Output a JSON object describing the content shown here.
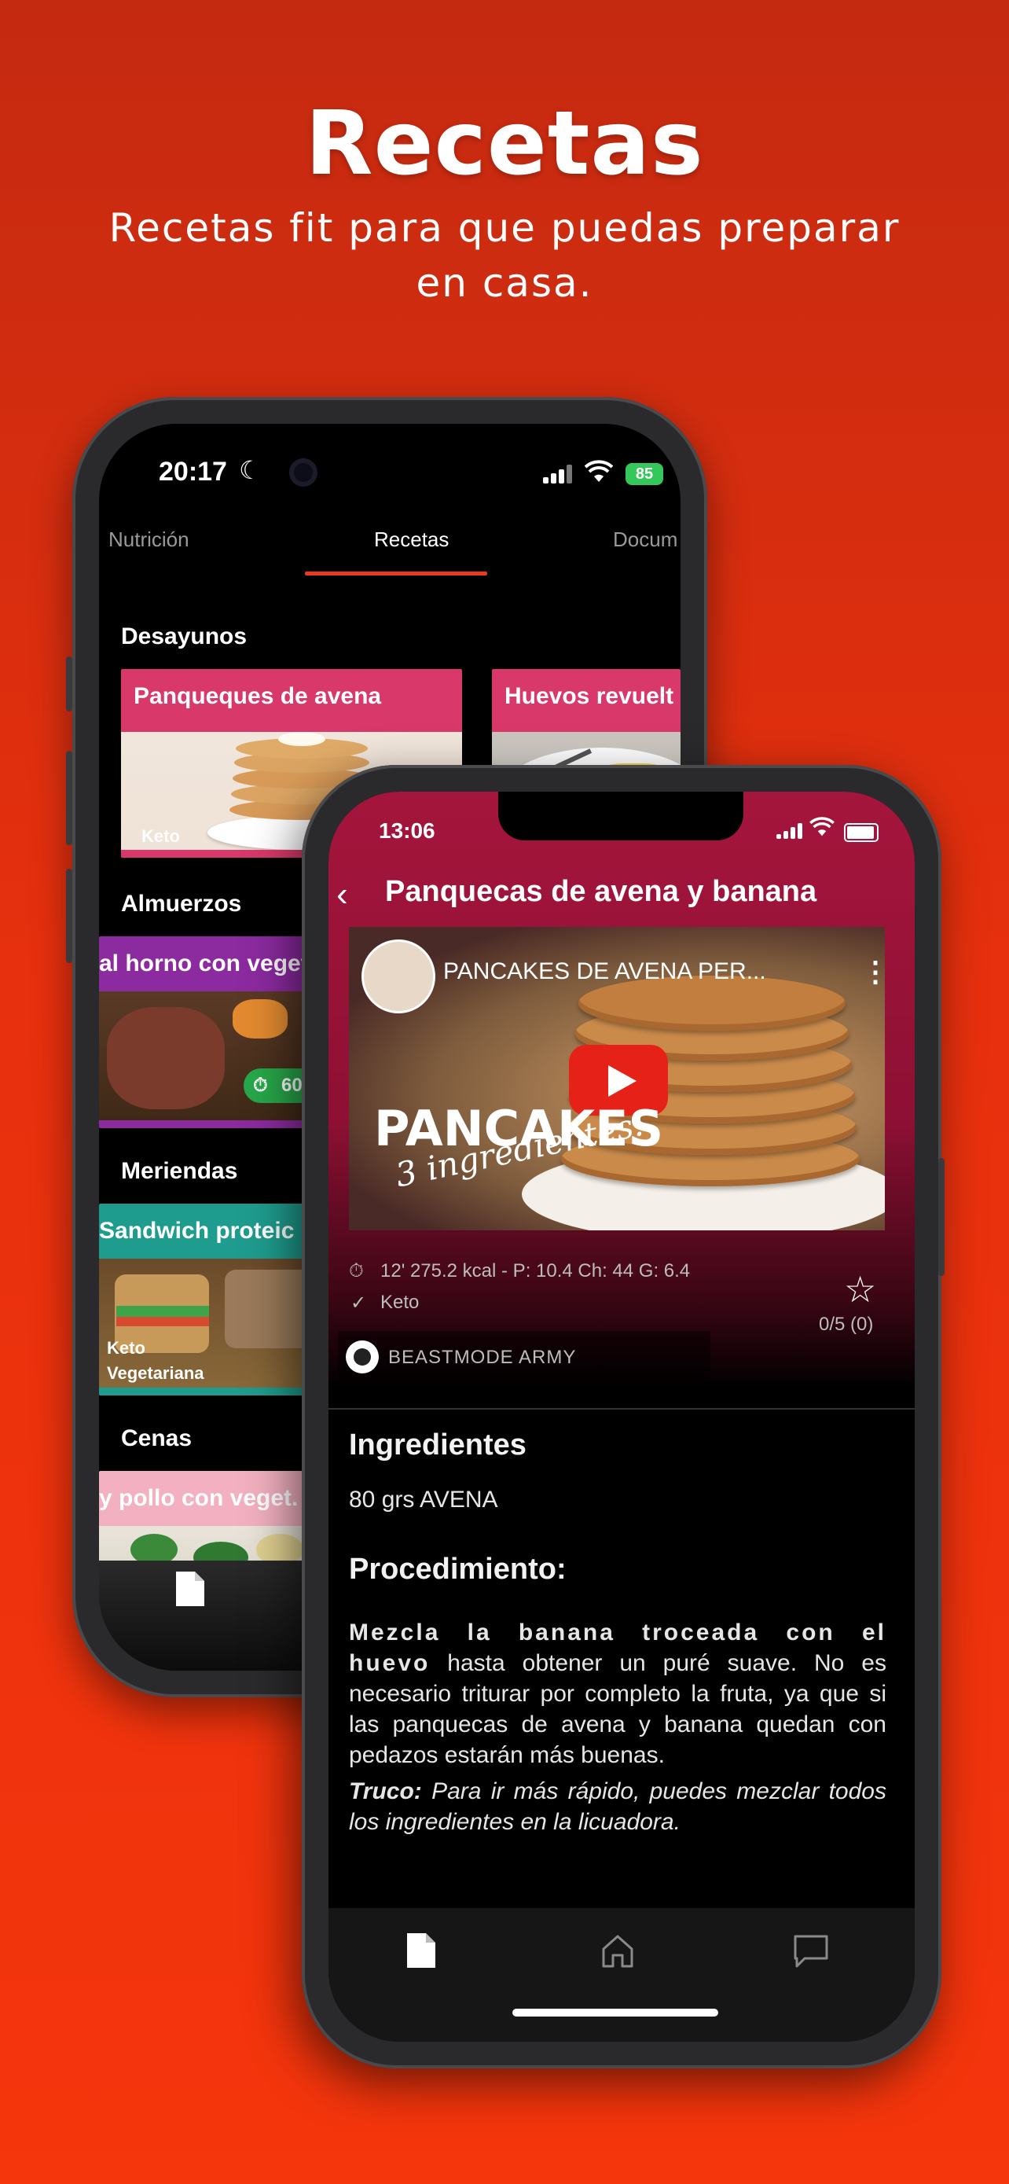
{
  "hero": {
    "title": "Recetas",
    "subtitle": "Recetas fit para que puedas preparar en casa."
  },
  "back_phone": {
    "status": {
      "time": "20:17",
      "battery": "85"
    },
    "tabs": [
      {
        "label": "Nutrición",
        "active": false
      },
      {
        "label": "Recetas",
        "active": true
      },
      {
        "label": "Docum",
        "active": false
      }
    ],
    "sections": [
      {
        "label": "Desayunos",
        "cards": [
          {
            "title": "Panqueques de avena",
            "badge": "Keto"
          },
          {
            "title": "Huevos revuelt"
          }
        ]
      },
      {
        "label": "Almuerzos",
        "cards": [
          {
            "title": "al horno con veget",
            "time": "60"
          }
        ]
      },
      {
        "label": "Meriendas",
        "cards": [
          {
            "title": "Sandwich proteic",
            "badge": "Keto",
            "badge2": "Vegetariana"
          }
        ]
      },
      {
        "label": "Cenas",
        "cards": [
          {
            "title": "y pollo con veget."
          }
        ]
      }
    ],
    "tabbar_icon": "document-icon"
  },
  "front_phone": {
    "status": {
      "time": "13:06"
    },
    "title": "Panquecas de avena y banana",
    "video": {
      "title": "PANCAKES DE AVENA PER...",
      "overlay_big": "PANCAKES",
      "overlay_script": "3 ingredientes!"
    },
    "meta": {
      "nutrition": "12' 275.2 kcal - P: 10.4 Ch: 44 G: 6.4",
      "tag": "Keto",
      "rating": "0/5 (0)",
      "author": "BEASTMODE ARMY"
    },
    "ingredients_heading": "Ingredientes",
    "ingredients": [
      "80 grs AVENA"
    ],
    "procedure_heading": "Procedimiento:",
    "procedure": {
      "bold": "Mezcla la banana troceada con el huevo",
      "rest": " hasta obtener un puré suave. No es necesario triturar por completo la fruta, ya que si las panquecas de avena y banana quedan con pedazos estarán más buenas."
    },
    "tip": {
      "label": "Truco:",
      "text": " Para ir más rápido, puedes mezclar todos los ingredientes en la licuadora."
    },
    "tabbar": [
      "document-icon",
      "home-icon",
      "chat-icon"
    ]
  },
  "colors": {
    "background": "#e7300e",
    "accent_underline": "#ee3a1c",
    "header_gradient": "#a5153c",
    "card_pink": "#d8386a",
    "youtube_red": "#e62117"
  }
}
